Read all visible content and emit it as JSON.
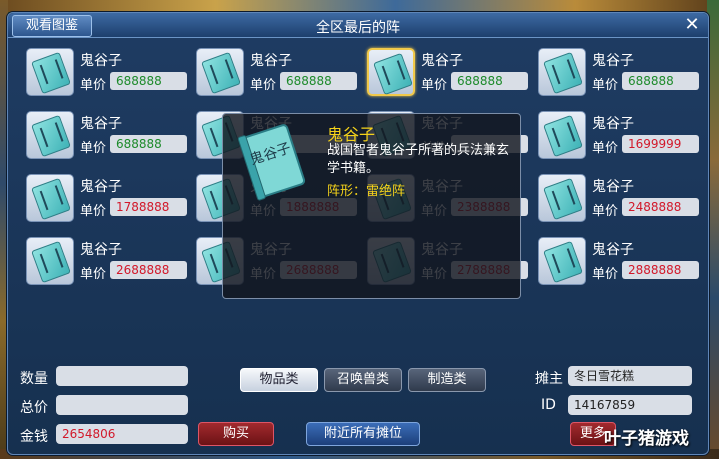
{
  "window": {
    "title": "全区最后的阵",
    "gallery_tab": "观看图鉴",
    "close_glyph": "✕"
  },
  "grid": {
    "price_label": "单价",
    "items": [
      {
        "name": "鬼谷子",
        "price": "688888",
        "price_color": "green",
        "selected": false
      },
      {
        "name": "鬼谷子",
        "price": "688888",
        "price_color": "green",
        "selected": false
      },
      {
        "name": "鬼谷子",
        "price": "688888",
        "price_color": "green",
        "selected": true
      },
      {
        "name": "鬼谷子",
        "price": "688888",
        "price_color": "green",
        "selected": false
      },
      {
        "name": "鬼谷子",
        "price": "688888",
        "price_color": "green",
        "selected": false
      },
      {
        "name": "鬼谷子",
        "price": "",
        "price_color": "green",
        "selected": false
      },
      {
        "name": "鬼谷子",
        "price": "",
        "price_color": "red",
        "selected": false
      },
      {
        "name": "鬼谷子",
        "price": "1699999",
        "price_color": "red",
        "selected": false
      },
      {
        "name": "鬼谷子",
        "price": "1788888",
        "price_color": "red",
        "selected": false
      },
      {
        "name": "鬼谷子",
        "price": "1888888",
        "price_color": "red",
        "selected": false
      },
      {
        "name": "鬼谷子",
        "price": "2388888",
        "price_color": "red",
        "selected": false
      },
      {
        "name": "鬼谷子",
        "price": "2488888",
        "price_color": "red",
        "selected": false
      },
      {
        "name": "鬼谷子",
        "price": "2688888",
        "price_color": "red",
        "selected": false
      },
      {
        "name": "鬼谷子",
        "price": "2688888",
        "price_color": "red",
        "selected": false
      },
      {
        "name": "鬼谷子",
        "price": "2788888",
        "price_color": "red",
        "selected": false
      },
      {
        "name": "鬼谷子",
        "price": "2888888",
        "price_color": "red",
        "selected": false
      }
    ]
  },
  "tooltip": {
    "name": "鬼谷子",
    "description": "战国智者鬼谷子所著的兵法兼玄学书籍。",
    "formation": "阵形：雷绝阵",
    "icon_text": "鬼谷子"
  },
  "bottom": {
    "quantity_label": "数量",
    "quantity_value": "",
    "total_label": "总价",
    "total_value": "",
    "money_label": "金钱",
    "money_value": "2654806",
    "buy_button": "购买",
    "nearby_button": "附近所有摊位",
    "categories": [
      "物品类",
      "召唤兽类",
      "制造类"
    ],
    "active_category": 0,
    "owner_label": "摊主",
    "owner_value": "冬日雪花糕",
    "id_label": "ID",
    "id_value": "14167859",
    "more_button": "更多"
  },
  "watermark": "叶子猪游戏",
  "colors": {
    "price_green": "#1c8a2a",
    "price_red": "#d2182a",
    "tooltip_gold": "#f4d21a",
    "window_bg": "#1f3c63"
  }
}
